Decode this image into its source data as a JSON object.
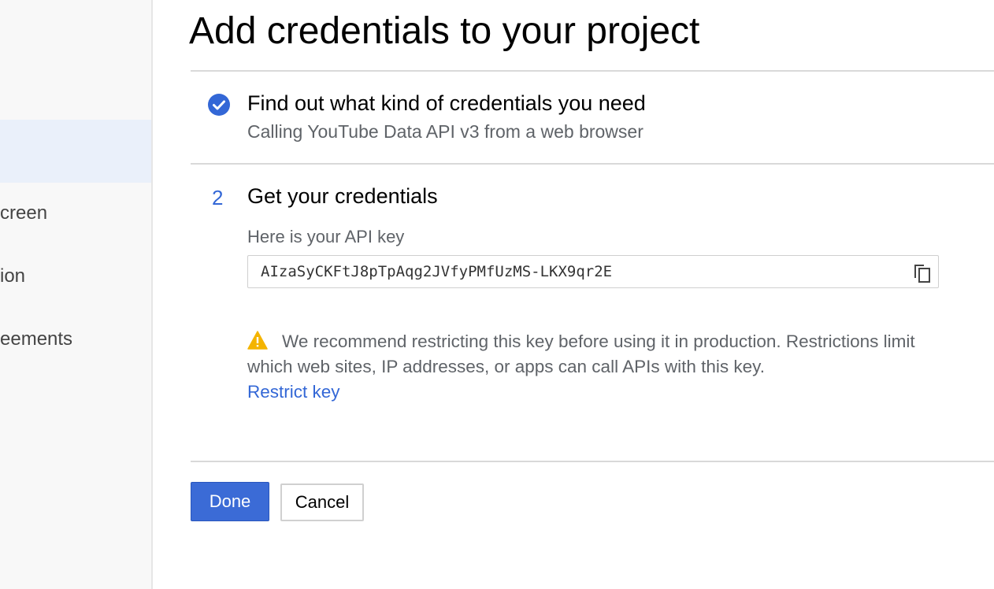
{
  "sidebar": {
    "items": [
      {
        "label": "creen"
      },
      {
        "label": "ion"
      },
      {
        "label": "eements"
      }
    ]
  },
  "main": {
    "title": "Add credentials to your project",
    "step1": {
      "title": "Find out what kind of credentials you need",
      "subtitle": "Calling YouTube Data API v3 from a web browser",
      "icon": "check-circle-icon"
    },
    "step2": {
      "number": "2",
      "title": "Get your credentials",
      "api_label": "Here is your API key",
      "api_key": "AIzaSyCKFtJ8pTpAqg2JVfyPMfUzMS-LKX9qr2E",
      "warning": "We recommend restricting this key before using it in production. Restrictions limit which web sites, IP addresses, or apps can call APIs with this key.",
      "restrict_link": "Restrict key"
    },
    "buttons": {
      "done": "Done",
      "cancel": "Cancel"
    }
  },
  "colors": {
    "accent": "#3367d6",
    "warning": "#f4b400",
    "sidebar_active": "#eaf0fa"
  }
}
